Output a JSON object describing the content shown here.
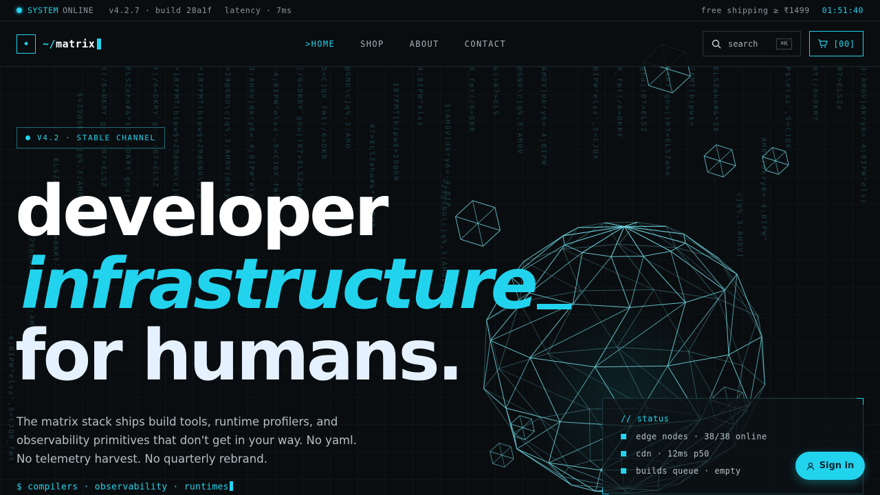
{
  "statusbar": {
    "system": "SYSTEM",
    "online": "ONLINE",
    "version": "v4.2.7 · build 28a1f",
    "latency": "latency · 7ms",
    "shipping": "free shipping ≥ ₹1499",
    "clock": "01:51:40"
  },
  "header": {
    "logo_glyph": "◆",
    "logo_tilde": "~/",
    "logo_name": "matrix",
    "nav": [
      ">HOME",
      "SHOP",
      "ABOUT",
      "CONTACT"
    ],
    "search_placeholder": "search",
    "search_shortcut": "⌘K",
    "cart_label": "[00]"
  },
  "hero": {
    "badge": "V4.2 · STABLE CHANNEL",
    "line1": "developer",
    "line2": "infrastructure",
    "line3": "for humans.",
    "lead": "The matrix stack ships build tools, runtime profilers, and observability primitives that don't get in your way. No yaml. No telemetry harvest. No quarterly rebrand.",
    "prompt": "$ compilers · observability · runtimes"
  },
  "status_panel": {
    "title": "// status",
    "rows": [
      "edge nodes · 38/38 online",
      "cdn · 12ms p50",
      "builds queue · empty"
    ]
  },
  "signin": {
    "label": "Sign in"
  },
  "rain": [
    "$+29@GNU\\cjq%,3:AHOV]dkry6",
    "ELSZaho#&*1870=DKRY`gnu|)",
    "t(/6=DKRY`gnu|)07>ELSZ",
    "*18?FMT[bipw$+29@GNU\\cjq",
    "+29@GNU\\cjq%,3:AHOV]dkry",
    "3:AHOV]dkry6=-4;BIPW^elsz",
    "-4;BIPW^elsz',5<CJQX_fmt",
    "|/6=DKRY`gnu|)07>ELSZaho",
    "5<CJQX_fmt(/6=DKR",
    "@GNU\\cjq%,3:AHO",
    "07>ELSZaho#&*18?FMT",
    "18?FMT[bipw$+29@GN",
    "4;BIPW^elsz",
    "3:AHOV]dkry6=-4;BIP",
    "X_fmt(/6=DKR",
    "u|)07>ELS",
    "@GNU\\cjq%,3:AHOV",
    "AHOV]dkry6=-4;BIPW",
    "BIPW^elsz',5<CJQX",
    "X_fmt(/6=DKRY",
    "gnu|)07>ELSZ",
    "DKRY`gnu|)07>ELSZaho",
    "?FMT[bipw$+",
    "ELSZaho#&*18",
    "cjq%,3:AHOV]",
    "AHOV]dkry6=-4;BIPW^",
    "P$\\elsz',5<CJQX",
    "et(/6=DKRY",
    "07>ELSZa"
  ]
}
